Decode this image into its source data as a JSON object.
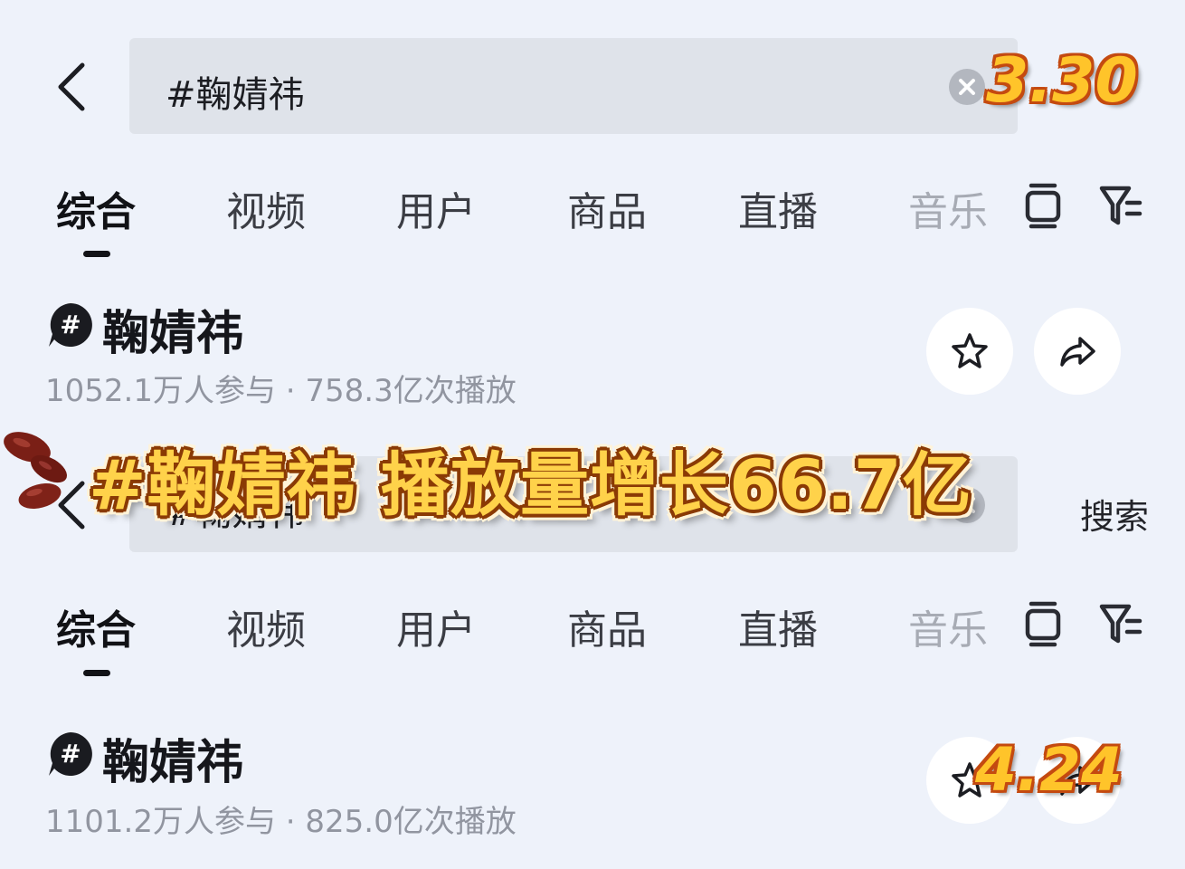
{
  "screen_top": {
    "search": {
      "query": "#鞠婧祎"
    },
    "tabs": [
      "综合",
      "视频",
      "用户",
      "商品",
      "直播",
      "音乐"
    ],
    "topic": {
      "title": "鞠婧祎",
      "stats": "1052.1万人参与 · 758.3亿次播放"
    },
    "date_label": "3.30"
  },
  "screen_bottom": {
    "search": {
      "query": "#鞠婧祎",
      "search_button": "搜索"
    },
    "tabs": [
      "综合",
      "视频",
      "用户",
      "商品",
      "直播",
      "音乐"
    ],
    "topic": {
      "title": "鞠婧祎",
      "stats": "1101.2万人参与 · 825.0亿次播放"
    },
    "date_label": "4.24"
  },
  "overlay": {
    "headline": "#鞠婧祎 播放量增长66.7亿",
    "sticker_icon": "red-beans-icon"
  },
  "colors": {
    "background": "#eef2fa",
    "search_box": "#dfe3ea",
    "headline_fill": "#ffd24a",
    "date_fill": "#ffc42a"
  }
}
